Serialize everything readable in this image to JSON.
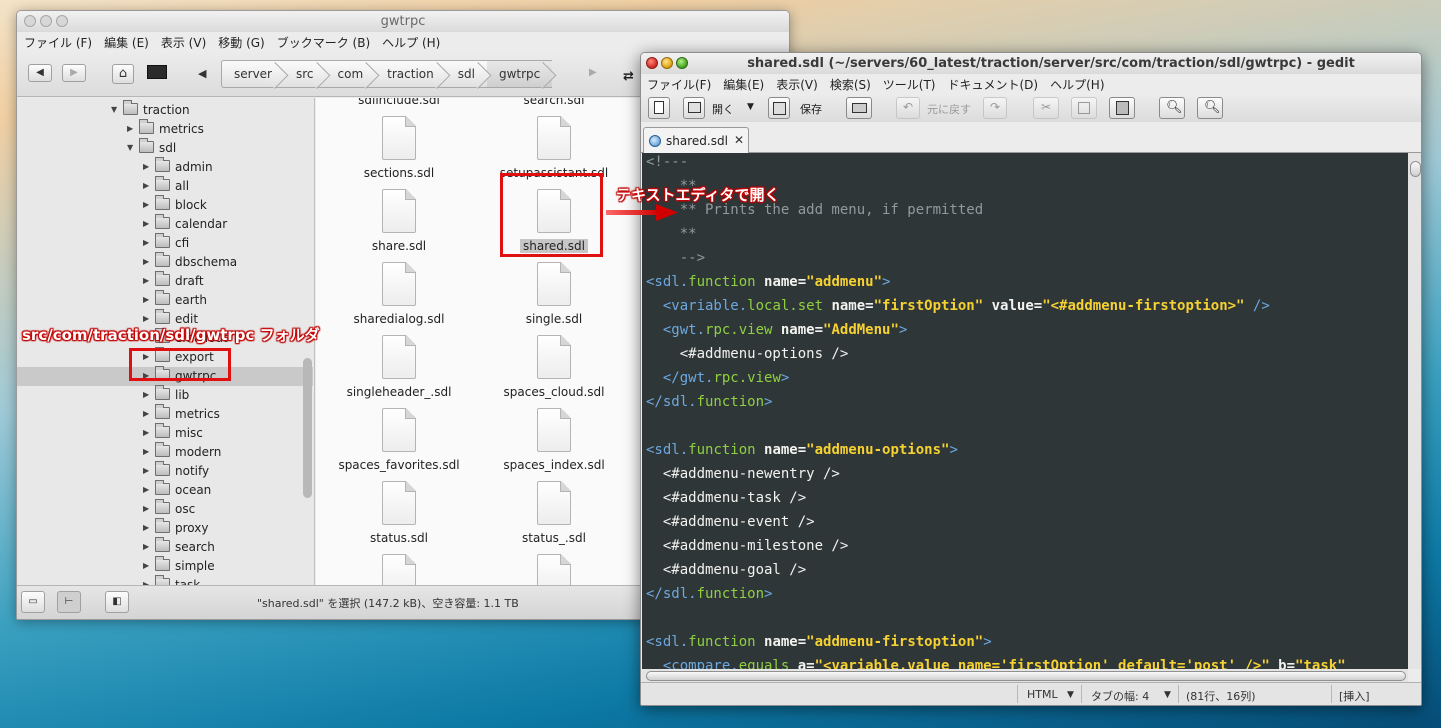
{
  "file_manager": {
    "title": "gwtrpc",
    "menu": [
      "ファイル (F)",
      "編集 (E)",
      "表示 (V)",
      "移動 (G)",
      "ブックマーク (B)",
      "ヘルプ (H)"
    ],
    "breadcrumbs": [
      "server",
      "src",
      "com",
      "traction",
      "sdl",
      "gwtrpc"
    ],
    "tree": [
      {
        "label": "traction",
        "expanded": true
      },
      {
        "label": "metrics",
        "expanded": false
      },
      {
        "label": "sdl",
        "expanded": true
      },
      {
        "label": "admin",
        "expanded": false
      },
      {
        "label": "all",
        "expanded": false
      },
      {
        "label": "block",
        "expanded": false
      },
      {
        "label": "calendar",
        "expanded": false
      },
      {
        "label": "cfi",
        "expanded": false
      },
      {
        "label": "dbschema",
        "expanded": false
      },
      {
        "label": "draft",
        "expanded": false
      },
      {
        "label": "earth",
        "expanded": false
      },
      {
        "label": "edit",
        "expanded": false
      },
      {
        "label": "emailout",
        "expanded": false
      },
      {
        "label": "export",
        "expanded": false
      },
      {
        "label": "gwtrpc",
        "expanded": false,
        "selected": true
      },
      {
        "label": "lib",
        "expanded": false
      },
      {
        "label": "metrics",
        "expanded": false
      },
      {
        "label": "misc",
        "expanded": false
      },
      {
        "label": "modern",
        "expanded": false
      },
      {
        "label": "notify",
        "expanded": false
      },
      {
        "label": "ocean",
        "expanded": false
      },
      {
        "label": "osc",
        "expanded": false
      },
      {
        "label": "proxy",
        "expanded": false
      },
      {
        "label": "search",
        "expanded": false
      },
      {
        "label": "simple",
        "expanded": false
      },
      {
        "label": "task",
        "expanded": false
      }
    ],
    "files": [
      [
        "sdlinclude.sdl",
        "search.sdl"
      ],
      [
        "sections.sdl",
        "setupassistant.sdl"
      ],
      [
        "share.sdl",
        "shared.sdl"
      ],
      [
        "sharedialog.sdl",
        "single.sdl"
      ],
      [
        "singleheader_.sdl",
        "spaces_cloud.sdl"
      ],
      [
        "spaces_favorites.sdl",
        "spaces_index.sdl"
      ],
      [
        "status.sdl",
        "status_.sdl"
      ],
      [
        "",
        ""
      ]
    ],
    "selected_file": "shared.sdl",
    "status_text": "\"shared.sdl\" を選択 (147.2 kB)、空き容量: 1.1 TB"
  },
  "gedit": {
    "title": "shared.sdl (~/servers/60_latest/traction/server/src/com/traction/sdl/gwtrpc) - gedit",
    "menu": [
      "ファイル(F)",
      "編集(E)",
      "表示(V)",
      "検索(S)",
      "ツール(T)",
      "ドキュメント(D)",
      "ヘルプ(H)"
    ],
    "toolbar": {
      "open_label": "開く",
      "save_label": "保存",
      "undo_label": "元に戻す"
    },
    "tab_label": "shared.sdl",
    "tab_close": "✕",
    "code_lines": [
      [
        [
          "com",
          "<!---"
        ]
      ],
      [
        [
          "com",
          "    **"
        ]
      ],
      [
        [
          "com",
          "    ** Prints the add menu, if permitted"
        ]
      ],
      [
        [
          "com",
          "    **"
        ]
      ],
      [
        [
          "com",
          "    -->"
        ]
      ],
      [
        [
          "tag",
          "<sdl."
        ],
        [
          "fn",
          "function"
        ],
        [
          "attr",
          " name="
        ],
        [
          "str",
          "\"addmenu\""
        ],
        [
          "tag",
          ">"
        ]
      ],
      [
        [
          "tag",
          "  <variable."
        ],
        [
          "fn",
          "local.set"
        ],
        [
          "attr",
          " name="
        ],
        [
          "str",
          "\"firstOption\""
        ],
        [
          "attr",
          " value="
        ],
        [
          "str",
          "\"<#addmenu-firstoption>\""
        ],
        [
          "tag",
          " />"
        ]
      ],
      [
        [
          "tag",
          "  <gwt."
        ],
        [
          "fn",
          "rpc.view"
        ],
        [
          "attr",
          " name="
        ],
        [
          "str",
          "\"AddMenu\""
        ],
        [
          "tag",
          ">"
        ]
      ],
      [
        [
          "txt",
          "    <#addmenu-options />"
        ]
      ],
      [
        [
          "tag",
          "  </gwt."
        ],
        [
          "fn",
          "rpc.view"
        ],
        [
          "tag",
          ">"
        ]
      ],
      [
        [
          "tag",
          "</sdl."
        ],
        [
          "fn",
          "function"
        ],
        [
          "tag",
          ">"
        ]
      ],
      [
        [
          "txt",
          ""
        ]
      ],
      [
        [
          "tag",
          "<sdl."
        ],
        [
          "fn",
          "function"
        ],
        [
          "attr",
          " name="
        ],
        [
          "str",
          "\"addmenu-options\""
        ],
        [
          "tag",
          ">"
        ]
      ],
      [
        [
          "txt",
          "  <#addmenu-newentry />"
        ]
      ],
      [
        [
          "txt",
          "  <#addmenu-task />"
        ]
      ],
      [
        [
          "txt",
          "  <#addmenu-event />"
        ]
      ],
      [
        [
          "txt",
          "  <#addmenu-milestone />"
        ]
      ],
      [
        [
          "txt",
          "  <#addmenu-goal />"
        ]
      ],
      [
        [
          "tag",
          "</sdl."
        ],
        [
          "fn",
          "function"
        ],
        [
          "tag",
          ">"
        ]
      ],
      [
        [
          "txt",
          ""
        ]
      ],
      [
        [
          "tag",
          "<sdl."
        ],
        [
          "fn",
          "function"
        ],
        [
          "attr",
          " name="
        ],
        [
          "str",
          "\"addmenu-firstoption\""
        ],
        [
          "tag",
          ">"
        ]
      ],
      [
        [
          "tag",
          "  <compare."
        ],
        [
          "fn",
          "equals"
        ],
        [
          "attr",
          " a="
        ],
        [
          "str",
          "\"<variable.value name='firstOption' default='post' />\""
        ],
        [
          "attr",
          " b="
        ],
        [
          "str",
          "\"task\""
        ]
      ]
    ],
    "status": {
      "language": "HTML",
      "tab_width": "タブの幅: 4",
      "position": "(81行、16列)",
      "mode": "[挿入]"
    }
  },
  "annotations": {
    "folder_label": "src/com/traction/sdl/gwtrpc フォルダ",
    "open_label": "テキストエディタで開く"
  },
  "colors": {
    "annotation_red": "#e01010",
    "editor_bg": "#2f3638",
    "string_yellow": "#f5d131",
    "function_green": "#8fd041",
    "tag_blue": "#6ca9e0"
  }
}
